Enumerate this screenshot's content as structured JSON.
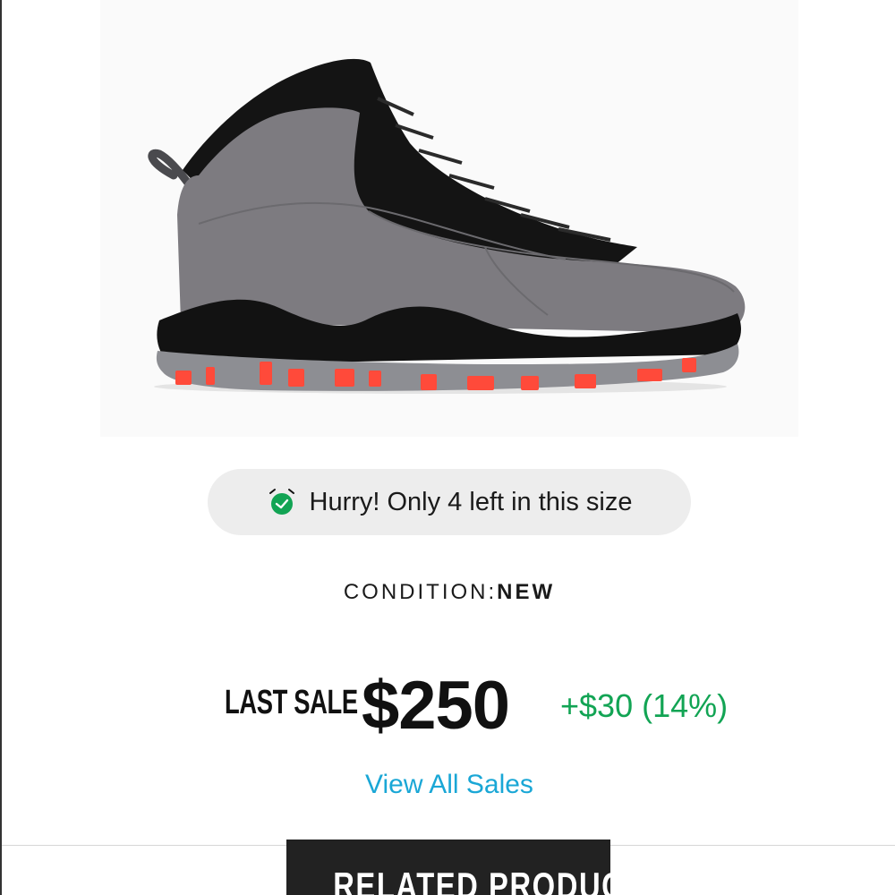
{
  "product": {
    "image_name": "sneaker-product-image",
    "colors": {
      "upper": "#7d7b80",
      "black": "#111111",
      "infrared": "#ff4a3a",
      "sole_grey": "#8d8e93"
    }
  },
  "stock_alert": {
    "icon": "alarm-clock-icon",
    "icon_color": "#12a454",
    "text": "Hurry! Only 4 left in this size"
  },
  "condition": {
    "label": "CONDITION:",
    "value": "NEW"
  },
  "last_sale": {
    "label": "LAST SALE",
    "price": "$250",
    "change": "+$30 (14%)",
    "change_color": "#12a454"
  },
  "links": {
    "view_all_sales": "View All Sales",
    "link_color": "#1aa7d6"
  },
  "related": {
    "tab_label": "RELATED PRODUCTS"
  }
}
